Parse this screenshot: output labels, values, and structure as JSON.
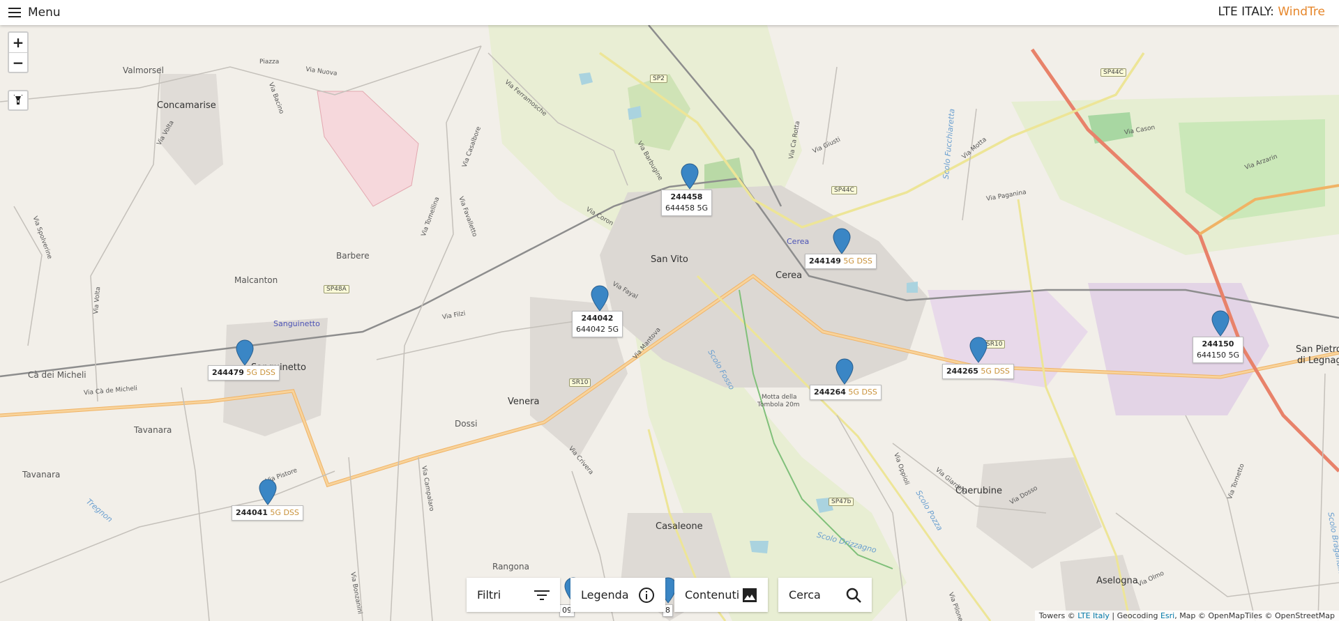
{
  "header": {
    "menu_label": "Menu",
    "brand_prefix": "LTE ITALY: ",
    "brand_operator": "WindTre"
  },
  "map_controls": {
    "zoom_in": "+",
    "zoom_out": "−"
  },
  "places": {
    "valmorsel": "Valmorsel",
    "piazza": "Piazza",
    "concamarise": "Concamarise",
    "barbere": "Barbere",
    "malcanton": "Malcanton",
    "sanguinetto_rail": "Sanguinetto",
    "sanguinetto": "Sanguinetto",
    "ca_dei_micheli": "Cà dei Micheli",
    "tavanara1": "Tavanara",
    "tavanara2": "Tavanara",
    "venera": "Venera",
    "dossi": "Dossi",
    "san_vito": "San Vito",
    "cerea": "Cerea",
    "cerea_rail": "Cerea",
    "casaleone": "Casaleone",
    "rangona": "Rangona",
    "cherubine": "Cherubine",
    "aselogna": "Aselogna",
    "san_pietro": "San Pietro",
    "di_legnago": "di Legnago",
    "motta": "Motta della",
    "tombola": "Tombola 20m"
  },
  "streets": {
    "via_nuova": "Via Nuova",
    "via_bacino": "Via Bacino",
    "via_volta_1": "Via Volta",
    "via_volta_2": "Via Volta",
    "via_spolverine": "Via Spolverine",
    "via_ca_de_micheli": "Via Cà de Micheli",
    "via_pistore": "Via Pistore",
    "via_filzi": "Via Filzi",
    "via_tomellina": "Via Tomellina",
    "via_favalletto": "Via Favalletto",
    "via_casalbore": "Via Casalbore",
    "via_ferramosche": "Via Ferramosche",
    "via_barbugine": "Via Barbugine",
    "via_coron": "Via Coron",
    "via_fayal": "Via Fayal",
    "via_mantova": "Via Mantova",
    "via_campalaro": "Via Campalaro",
    "via_crivera": "Via Crivera",
    "via_bonzanini": "Via Bonzanini",
    "via_giusti": "Via Giusti",
    "via_ca_rotta": "Via Ca Rotta",
    "via_motta": "Via Motta",
    "via_paganina": "Via Paganina",
    "via_cason": "Via Cason",
    "via_arzarin": "Via Arzarin",
    "via_oppioli": "Via Oppioli",
    "via_giardino": "Via Giardino",
    "via_dosso": "Via Dosso",
    "via_olmo": "Via Olmo",
    "via_pilone": "Via Pilone",
    "via_tornetto": "Via Tornetto"
  },
  "water": {
    "scolo_fosso": "Scolo Fosso",
    "scolo_fucchiaretta": "Scolo Fucchiaretta",
    "tregnon": "Tregnon",
    "scolo_drizzagno": "Scolo Drizzagno",
    "scolo_pozza": "Scolo Pozza",
    "scolo_brandina": "Scolo Bragandina"
  },
  "road_tags": [
    "SP2",
    "SP44C",
    "SP44C",
    "SP48A",
    "SR10",
    "SR10",
    "SP47b"
  ],
  "towers": [
    {
      "id": "244458",
      "line2": "644458",
      "tech": "5G",
      "dss": ""
    },
    {
      "id": "244149",
      "line2": "",
      "tech": "",
      "dss": "5G DSS"
    },
    {
      "id": "244042",
      "line2": "644042",
      "tech": "5G",
      "dss": ""
    },
    {
      "id": "244479",
      "line2": "",
      "tech": "",
      "dss": "5G DSS"
    },
    {
      "id": "244265",
      "line2": "",
      "tech": "",
      "dss": "5G DSS"
    },
    {
      "id": "244264",
      "line2": "",
      "tech": "",
      "dss": "5G DSS"
    },
    {
      "id": "244150",
      "line2": "644150",
      "tech": "5G",
      "dss": ""
    },
    {
      "id": "244041",
      "line2": "",
      "tech": "",
      "dss": "5G DSS"
    }
  ],
  "partial_labels": [
    "09",
    "8"
  ],
  "toolbar": {
    "filters": "Filtri",
    "legend": "Legenda",
    "contents": "Contenuti",
    "search": "Cerca"
  },
  "attribution": {
    "towers": "Towers © ",
    "lte": "LTE Italy",
    "geo": " | Geocoding ",
    "esri": "Esri",
    "map": ", Map © OpenMapTiles © OpenStreetMap"
  },
  "colors": {
    "marker": "#3a86c5",
    "dss": "#c9923a",
    "brand": "#e6862a"
  }
}
